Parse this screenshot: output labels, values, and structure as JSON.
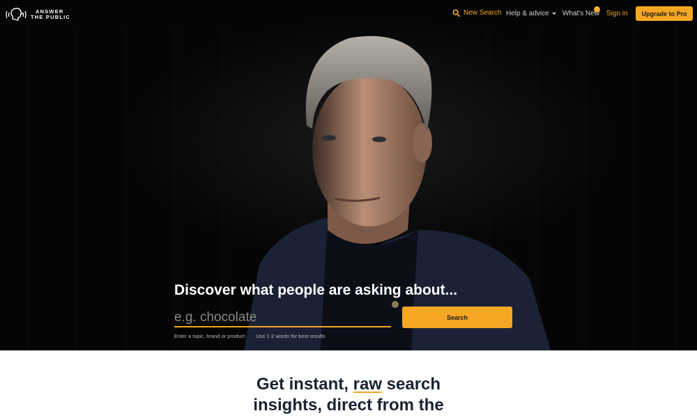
{
  "nav": {
    "logo_line1": "ANSWER",
    "logo_line2": "THE PUBLIC",
    "new_search": "New Search",
    "help": "Help & advice",
    "whats_new": "What's New",
    "whats_new_badge": "!",
    "sign_in": "Sign in",
    "upgrade": "Upgrade to Pro",
    "icons": {
      "logo": "head-with-soundwaves-logo",
      "new_search": "search-icon",
      "help": "chevron-down-icon"
    }
  },
  "hero": {
    "headline": "Discover what people are asking about...",
    "search_placeholder": "e.g. chocolate",
    "search_button": "Search",
    "hint_left": "Enter a topic, brand or product",
    "hint_right": "Use 1-2 words for best results",
    "image": "portrait-of-man-in-dark-jacket"
  },
  "section": {
    "title_before": "Get instant, ",
    "title_highlight": "raw",
    "title_after": " search",
    "title_line2": "insights, direct from the"
  },
  "colors": {
    "accent": "#f5a623",
    "hero_bg": "#050505",
    "heading_text": "#1b2230"
  }
}
